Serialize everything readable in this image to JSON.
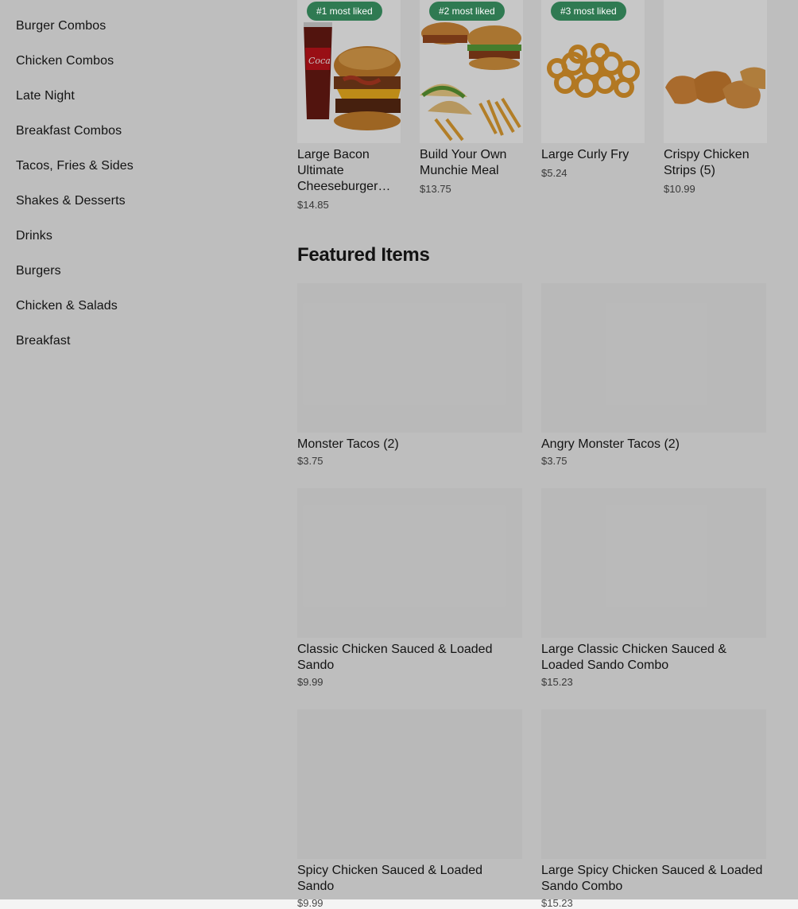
{
  "theme": {
    "badge_color": "#2f7a52",
    "placeholder_color": "#eeeeee"
  },
  "categories": [
    "Burger Combos",
    "Chicken Combos",
    "Late Night",
    "Breakfast Combos",
    "Tacos, Fries & Sides",
    "Shakes & Desserts",
    "Drinks",
    "Burgers",
    "Chicken & Salads",
    "Breakfast"
  ],
  "most_liked": [
    {
      "badge": "#1 most liked",
      "name": "Large Bacon Ultimate Cheeseburger Combo",
      "price": "$14.85",
      "image": "burger-combo-image"
    },
    {
      "badge": "#2 most liked",
      "name": "Build Your Own Munchie Meal",
      "price": "$13.75",
      "image": "munchie-meal-image"
    },
    {
      "badge": "#3 most liked",
      "name": "Large Curly Fry",
      "price": "$5.24",
      "image": "curly-fry-image"
    },
    {
      "badge": "",
      "name": "Crispy Chicken Strips (5)",
      "price": "$10.99",
      "image": "chicken-strips-image"
    }
  ],
  "featured": {
    "title": "Featured Items",
    "items": [
      {
        "name": "Monster Tacos (2)",
        "price": "$3.75"
      },
      {
        "name": "Angry Monster Tacos (2)",
        "price": "$3.75"
      },
      {
        "name": "Classic Chicken Sauced & Loaded Sando",
        "price": "$9.99"
      },
      {
        "name": "Large Classic Chicken Sauced & Loaded Sando Combo",
        "price": "$15.23"
      },
      {
        "name": "Spicy Chicken Sauced & Loaded Sando",
        "price": "$9.99"
      },
      {
        "name": "Large Spicy Chicken Sauced & Loaded Sando Combo",
        "price": "$15.23"
      }
    ]
  }
}
